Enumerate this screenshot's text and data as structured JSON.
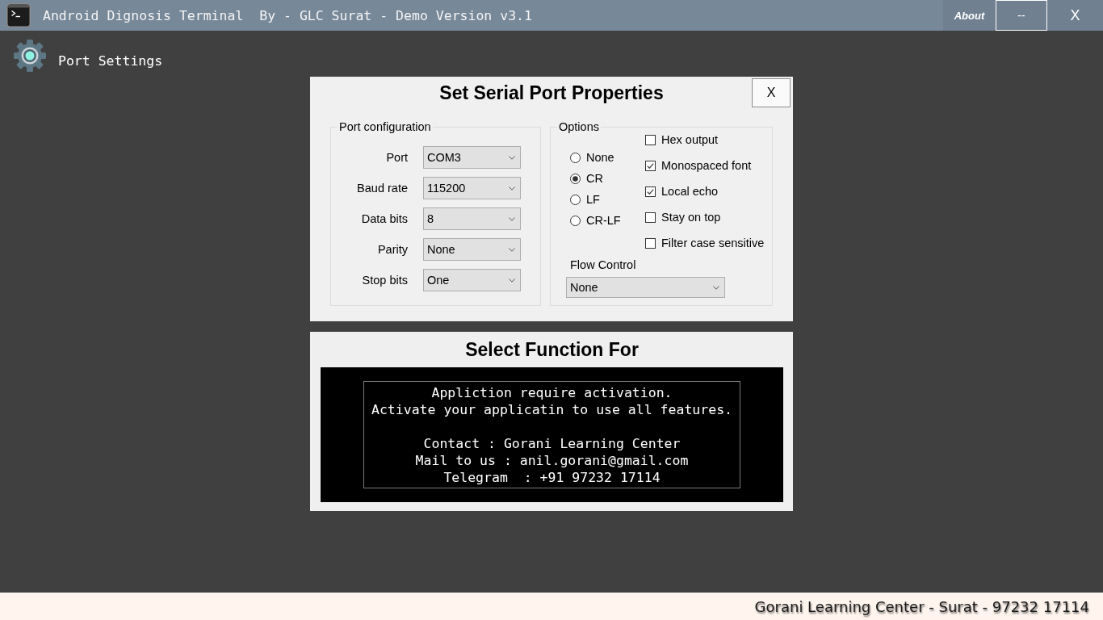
{
  "window": {
    "title": "Android Dignosis Terminal  By - GLC Surat - Demo Version v3.1",
    "buttons": [
      {
        "kind": "about",
        "label": "About"
      },
      {
        "kind": "minimize",
        "label": "--"
      },
      {
        "kind": "close",
        "label": "X"
      }
    ]
  },
  "page_header": {
    "title": "Port Settings"
  },
  "serial_dialog": {
    "title": "Set Serial Port Properties",
    "close_button": "X",
    "port_configuration": {
      "legend": "Port configuration",
      "fields": [
        {
          "label": "Port",
          "value": "COM3"
        },
        {
          "label": "Baud rate",
          "value": "115200"
        },
        {
          "label": "Data bits",
          "value": "8"
        },
        {
          "label": "Parity",
          "value": "None"
        },
        {
          "label": "Stop bits",
          "value": "One"
        }
      ]
    },
    "options": {
      "legend": "Options",
      "line_endings": [
        {
          "label": "None",
          "selected": false
        },
        {
          "label": "CR",
          "selected": true
        },
        {
          "label": "LF",
          "selected": false
        },
        {
          "label": "CR-LF",
          "selected": false
        }
      ],
      "checkboxes": [
        {
          "label": "Hex output",
          "checked": false
        },
        {
          "label": "Monospaced font",
          "checked": true
        },
        {
          "label": "Local echo",
          "checked": true
        },
        {
          "label": "Stay on top",
          "checked": false
        },
        {
          "label": "Filter case sensitive",
          "checked": false
        }
      ],
      "flow_control": {
        "label": "Flow Control",
        "value": "None"
      }
    }
  },
  "function_panel": {
    "title": "Select Function For",
    "message_lines": [
      "Appliction require activation.",
      "Activate your applicatin to use all features."
    ],
    "contact_lines": [
      "Contact : Gorani Learning Center",
      "Mail to us : anil.gorani@gmail.com",
      "Telegram  : +91 97232 17114"
    ]
  },
  "footer": {
    "text": "Gorani Learning Center - Surat - 97232 17114"
  }
}
